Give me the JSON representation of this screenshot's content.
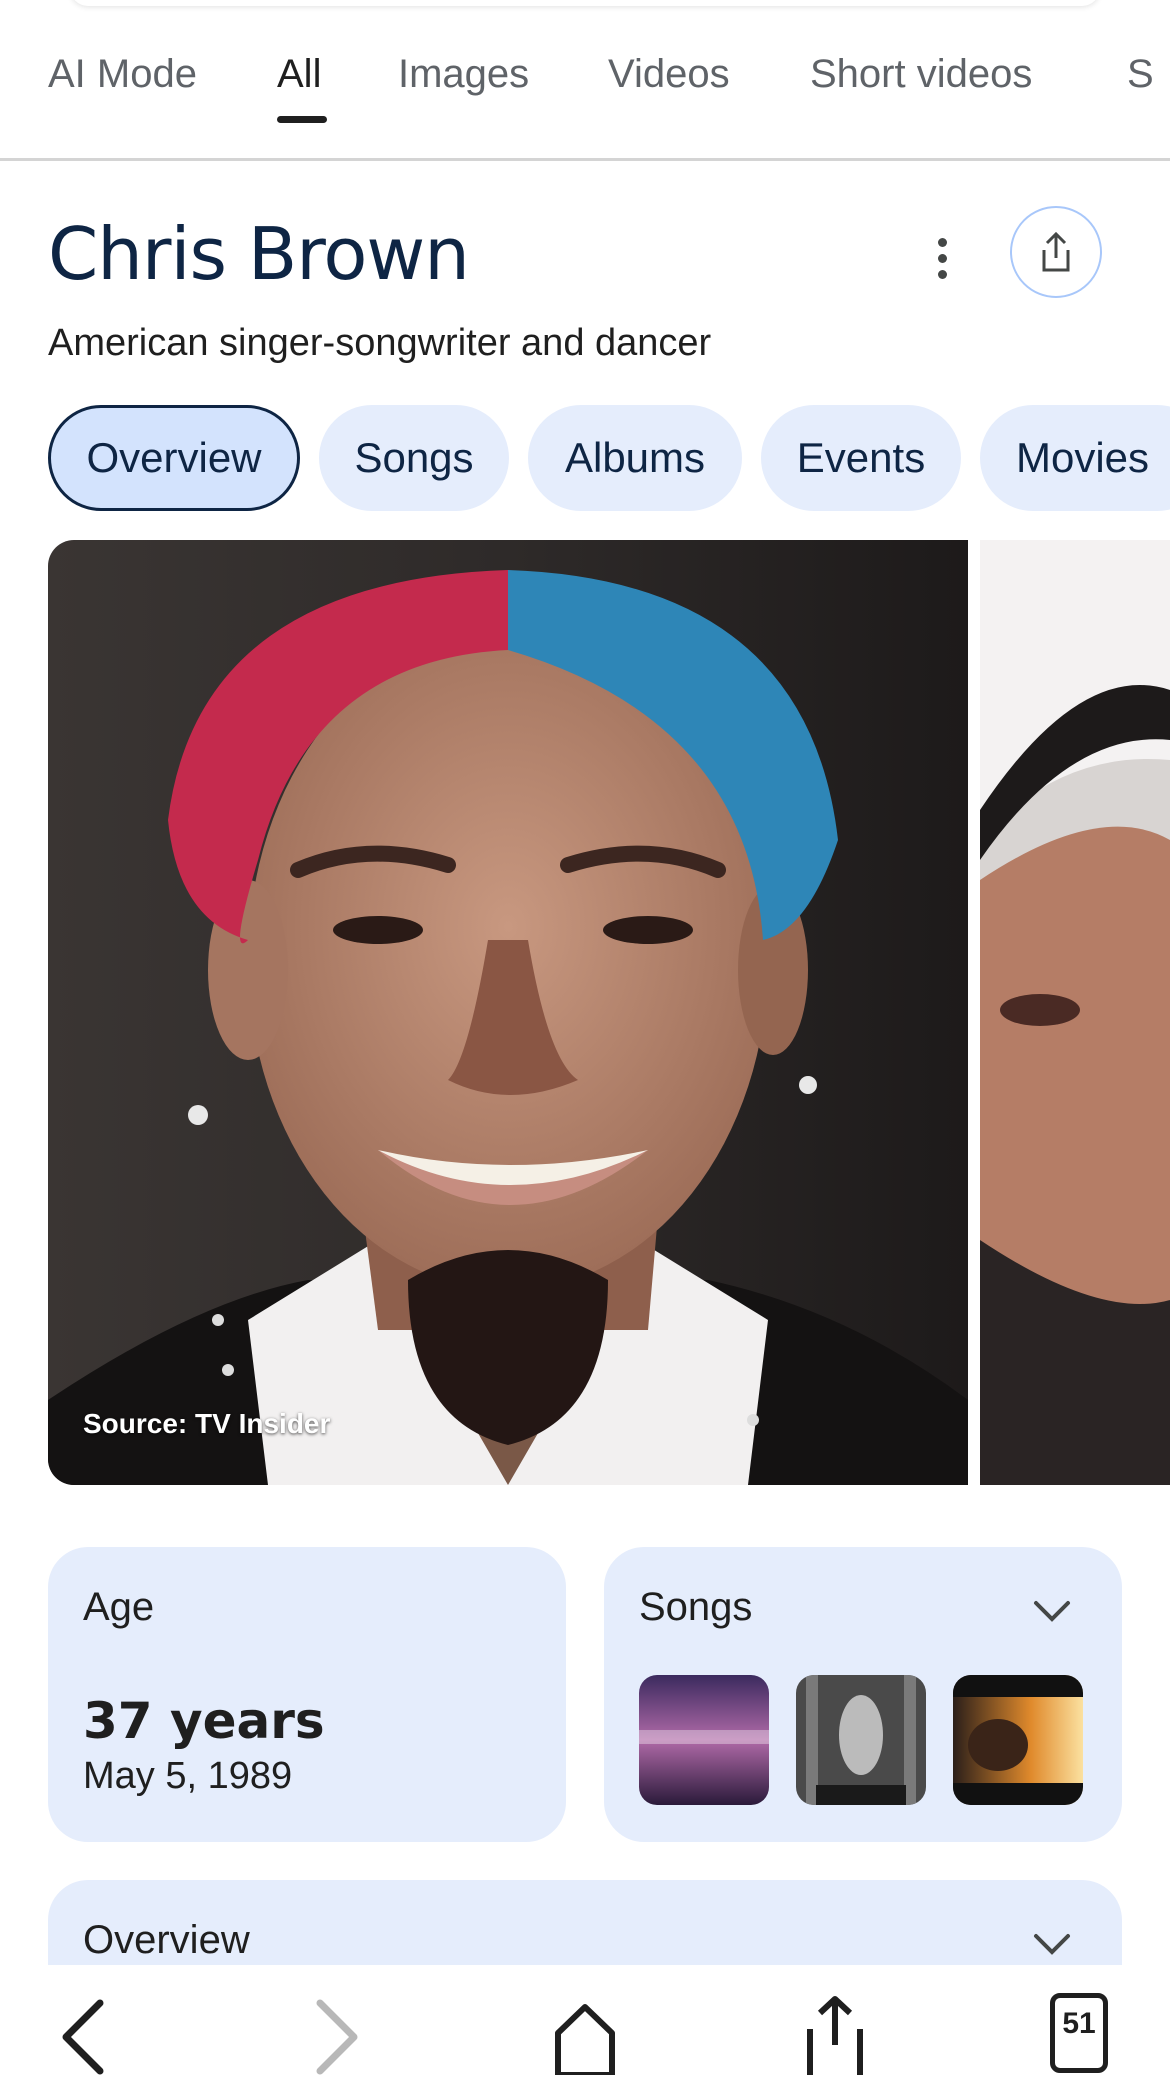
{
  "tabs": [
    {
      "label": "AI Mode",
      "active": false
    },
    {
      "label": "All",
      "active": true
    },
    {
      "label": "Images",
      "active": false
    },
    {
      "label": "Videos",
      "active": false
    },
    {
      "label": "Short videos",
      "active": false
    },
    {
      "label": "S",
      "active": false
    }
  ],
  "knowledge_panel": {
    "title": "Chris Brown",
    "subtitle": "American singer-songwriter and dancer",
    "more_icon": "more-vert-icon",
    "share_icon": "share-icon"
  },
  "chips": [
    {
      "label": "Overview",
      "selected": true
    },
    {
      "label": "Songs",
      "selected": false
    },
    {
      "label": "Albums",
      "selected": false
    },
    {
      "label": "Events",
      "selected": false
    },
    {
      "label": "Movies",
      "selected": false
    }
  ],
  "photo": {
    "source": "Source: TV Insider"
  },
  "age_card": {
    "label": "Age",
    "value": "37 years",
    "date": "May 5, 1989"
  },
  "songs_card": {
    "label": "Songs",
    "thumbnails": [
      "song-thumbnail-1",
      "song-thumbnail-2",
      "song-thumbnail-3"
    ]
  },
  "overview_card": {
    "label": "Overview"
  },
  "navbar": {
    "tabs_count": "51",
    "icons": [
      "back-icon",
      "forward-icon",
      "home-icon",
      "share-icon",
      "tabs-icon"
    ]
  },
  "colors": {
    "title": "#0e2544",
    "chip_bg": "#e5edfc",
    "chip_selected_bg": "#d3e3fd",
    "card_bg": "#e5edfc",
    "share_border": "#a8c7fa"
  }
}
